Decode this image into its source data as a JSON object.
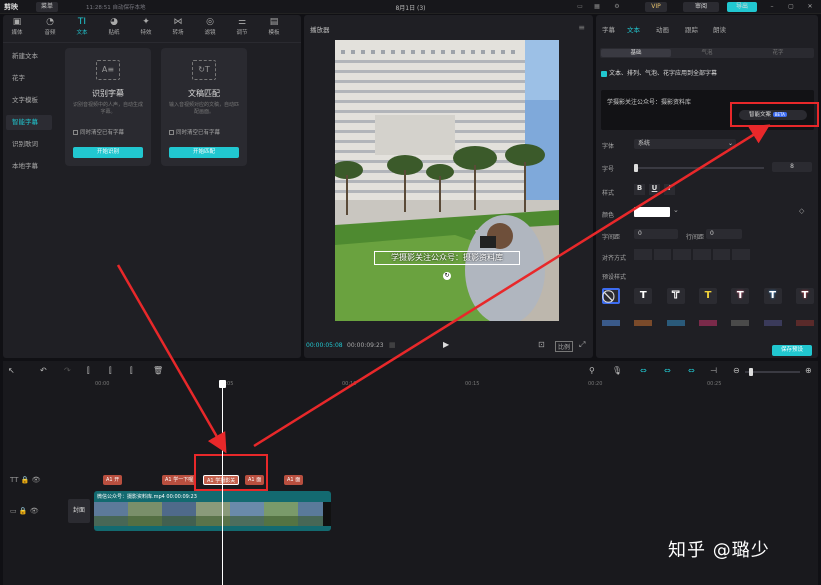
{
  "titlebar": {
    "app_name": "剪映",
    "menu_label": "菜单",
    "autosave": "11:28:51 自动保存本地",
    "project_title": "8月1日 (3)",
    "vip_label": "VIP",
    "review_label": "审阅",
    "export_label": "导出"
  },
  "toolbar": {
    "tabs": [
      {
        "label": "媒体",
        "icon": "media-icon"
      },
      {
        "label": "音频",
        "icon": "audio-icon"
      },
      {
        "label": "文本",
        "icon": "text-icon"
      },
      {
        "label": "贴纸",
        "icon": "sticker-icon"
      },
      {
        "label": "特效",
        "icon": "effects-icon"
      },
      {
        "label": "转场",
        "icon": "transition-icon"
      },
      {
        "label": "滤镜",
        "icon": "filter-icon"
      },
      {
        "label": "调节",
        "icon": "adjust-icon"
      },
      {
        "label": "模板",
        "icon": "template-icon"
      }
    ]
  },
  "leftnav": {
    "items": [
      "新建文本",
      "花字",
      "文字模板",
      "智能字幕",
      "识别歌词",
      "本地字幕"
    ]
  },
  "cards": [
    {
      "title": "识别字幕",
      "desc": "识别音视频中的人声，自动生成字幕。",
      "checkbox": "同时清空已有字幕",
      "button": "开始识别"
    },
    {
      "title": "文稿匹配",
      "desc": "输入音视频对应的文稿，自动匹配画面。",
      "checkbox": "同时清空已有字幕",
      "button": "开始匹配"
    }
  ],
  "player": {
    "title": "播放器",
    "subtitle_text": "学摄影关注公众号：摄影资料库",
    "current_time": "00:00:05:08",
    "total_time": "00:00:09:23",
    "ratio_label": "比例"
  },
  "rightpanel": {
    "tabs": [
      "字幕",
      "文本",
      "动画",
      "跟踪",
      "朗读"
    ],
    "subtabs": [
      "基础",
      "气泡",
      "花字"
    ],
    "apply_all": "文本、排列、气泡、花字应用到全部字幕",
    "text_value": "学摄影关注公众号：摄影资料库",
    "smart_label": "智能文案",
    "beta": "BETA",
    "font_label": "字体",
    "font_value": "系统",
    "size_label": "字号",
    "size_value": "8",
    "style_label": "样式",
    "color_label": "颜色",
    "char_spacing_label": "字间距",
    "char_spacing_value": "0",
    "line_spacing_label": "行间距",
    "line_spacing_value": "0",
    "align_label": "对齐方式",
    "preset_label": "预设样式",
    "save_preset": "保存预设"
  },
  "timeline": {
    "ruler": [
      "00:00",
      "00:05",
      "00:10",
      "00:15",
      "00:20",
      "00:25"
    ],
    "subtitle_clips": [
      "A1 开",
      "A1 学一下喔",
      "A1 学摄影关",
      "A1 面",
      "A1 面"
    ],
    "video_clip_label": "微信公众号：摄影资料库.mp4  00:00:09:23",
    "cover_label": "封面"
  },
  "watermark": "知乎 @璐少",
  "colors": {
    "accent": "#21c7d0",
    "annotation": "#e8282a",
    "clip": "#b84f3f",
    "video_track": "#136a70"
  }
}
